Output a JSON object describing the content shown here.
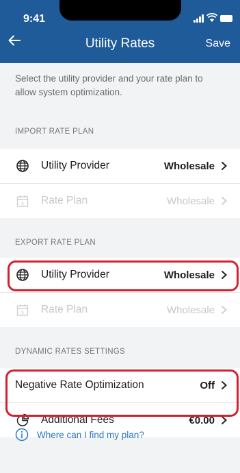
{
  "status_bar": {
    "time": "9:41"
  },
  "header": {
    "title": "Utility Rates",
    "save_label": "Save"
  },
  "description": "Select the utility provider and your rate plan to allow system optimization.",
  "import_section": {
    "heading": "IMPORT RATE PLAN",
    "provider": {
      "label": "Utility Provider",
      "value": "Wholesale",
      "icon": "globe-icon"
    },
    "plan": {
      "label": "Rate Plan",
      "value": "Wholesale",
      "icon": "calendar-dollar-icon"
    }
  },
  "export_section": {
    "heading": "EXPORT RATE PLAN",
    "provider": {
      "label": "Utility Provider",
      "value": "Wholesale",
      "icon": "globe-icon"
    },
    "plan": {
      "label": "Rate Plan",
      "value": "Wholesale",
      "icon": "calendar-dollar-icon"
    }
  },
  "dynamic_section": {
    "heading": "DYNAMIC RATES SETTINGS",
    "negative": {
      "label": "Negative Rate Optimization",
      "value": "Off"
    },
    "fees": {
      "label": "Additional Fees",
      "value": "€0.00",
      "icon": "pie-chart-icon"
    }
  },
  "help_link": {
    "text": "Where can I find my plan?",
    "icon": "info-icon"
  },
  "colors": {
    "header": "#1f5a99",
    "highlight": "#d51f2f",
    "link": "#2a78c6"
  }
}
